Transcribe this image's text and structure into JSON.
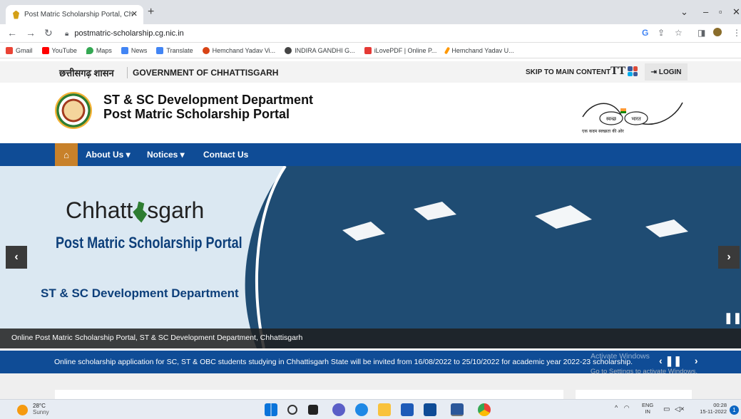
{
  "browser": {
    "tab_title": "Post Matric Scholarship Portal, Ch",
    "url": "postmatric-scholarship.cg.nic.in",
    "bookmarks": [
      "Gmail",
      "YouTube",
      "Maps",
      "News",
      "Translate",
      "Hemchand Yadav Vi...",
      "INDIRA GANDHI G...",
      "iLovePDF | Online P...",
      "Hemchand Yadav U..."
    ]
  },
  "govbar": {
    "hindi_label": "छत्तीसगढ़ शासन",
    "govt_label": "GOVERNMENT OF CHHATTISGARH",
    "skip_label": "SKIP TO MAIN CONTENT",
    "text_size_label": "TT",
    "login_label": "LOGIN"
  },
  "header": {
    "dept_line1": "ST & SC Development Department",
    "dept_line2": "Post Matric Scholarship Portal",
    "swachh_left": "स्वच्छ",
    "swachh_right": "भारत",
    "swachh_tagline": "एक कदम स्वच्छता की ओर"
  },
  "nav": {
    "about": "About Us ▾",
    "notices": "Notices ▾",
    "contact": "Contact Us"
  },
  "hero": {
    "brand_pre": "Chhatt",
    "brand_post": "sgarh",
    "portal": "Post Matric Scholarship Portal",
    "dept": "ST & SC Development Department",
    "caption": "Online Post Matric Scholarship Portal, ST & SC Development Department, Chhattisgarh"
  },
  "ticker": {
    "text": "Online scholarship application for SC, ST & OBC students studying in Chhattisgarh State will be invited from 16/08/2022 to 25/10/2022 for academic year 2022-23 scholarship.",
    "watermark_title": "Activate Windows",
    "watermark_sub": "Go to Settings to activate Windows."
  },
  "taskbar": {
    "temp": "28°C",
    "weather": "Sunny",
    "lang_line1": "ENG",
    "lang_line2": "IN",
    "time": "00:28",
    "date": "15-11-2022",
    "notif_count": "1"
  },
  "colors": {
    "nav_blue": "#0f4c96",
    "home_orange": "#c8812a",
    "hero_silhouette": "#1f4c73"
  }
}
